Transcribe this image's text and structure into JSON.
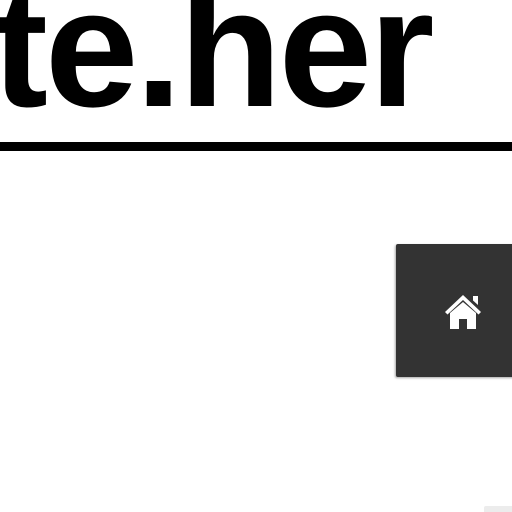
{
  "site": {
    "title": "te.her"
  },
  "home_button": {
    "icon": "home-icon"
  },
  "colors": {
    "background": "#ffffff",
    "title_text": "#000000",
    "header_rule": "#000000",
    "home_button_bg": "#333333",
    "home_icon": "#ffffff"
  }
}
